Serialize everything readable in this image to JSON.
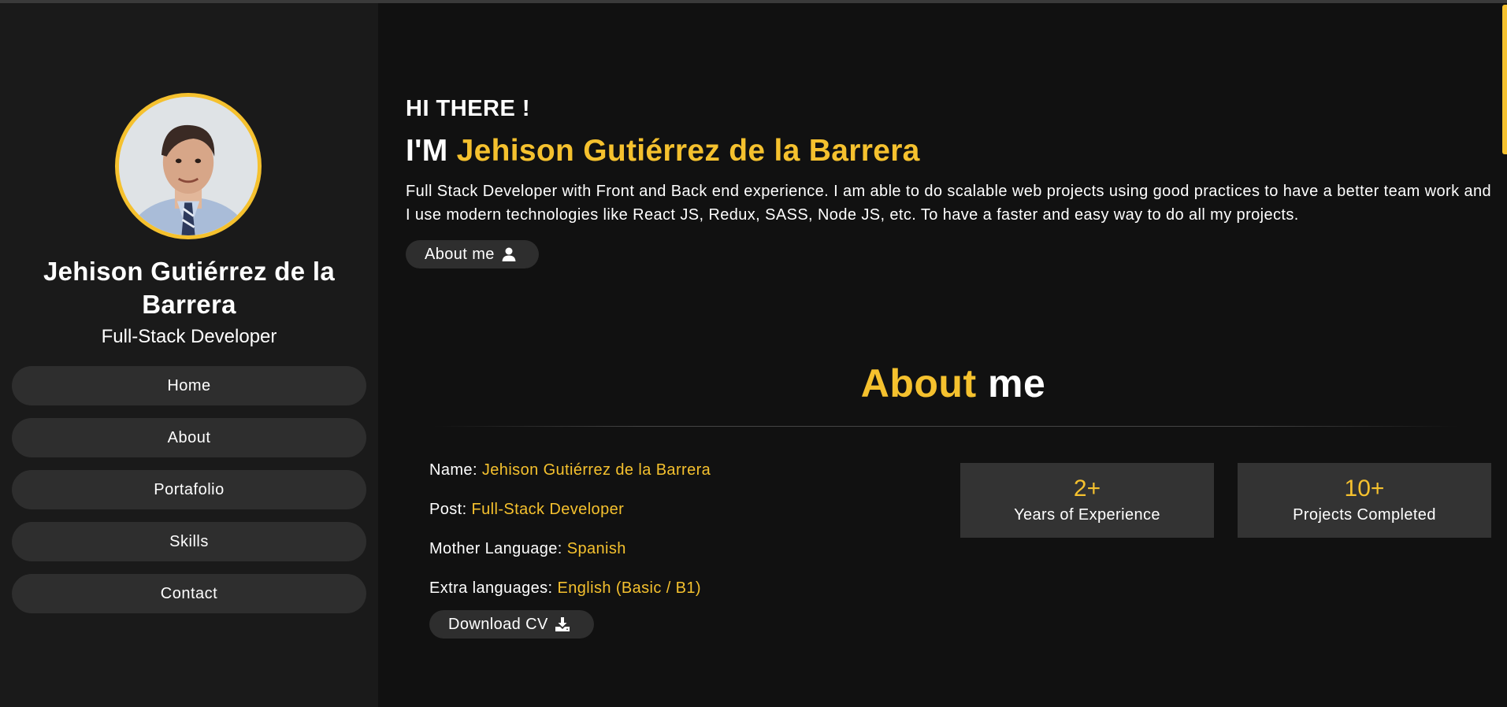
{
  "sidebar": {
    "profile_name": "Jehison Gutiérrez de la Barrera",
    "profile_role": "Full-Stack Developer",
    "nav_items": [
      {
        "label": "Home"
      },
      {
        "label": "About"
      },
      {
        "label": "Portafolio"
      },
      {
        "label": "Skills"
      },
      {
        "label": "Contact"
      }
    ]
  },
  "hero": {
    "greeting": "HI THERE !",
    "headline_prefix": "I'M ",
    "headline_name": "Jehison Gutiérrez de la Barrera",
    "intro": "Full Stack Developer with Front and Back end experience. I am able to do scalable web projects using good practices to have a better team work and I use modern technologies like React JS, Redux, SASS, Node JS, etc. To have a faster and easy way to do all my projects.",
    "about_button_label": "About me",
    "about_button_icon": "user-icon"
  },
  "about": {
    "title_accent": "About",
    "title_rest": " me",
    "info": [
      {
        "label": "Name: ",
        "value": "Jehison Gutiérrez de la Barrera"
      },
      {
        "label": "Post: ",
        "value": "Full-Stack Developer"
      },
      {
        "label": "Mother Language: ",
        "value": "Spanish"
      },
      {
        "label": "Extra languages: ",
        "value": "English (Basic / B1)"
      }
    ],
    "download_button_label": "Download CV",
    "download_button_icon": "download-icon",
    "stats": [
      {
        "value": "2+",
        "label": "Years of Experience"
      },
      {
        "value": "10+",
        "label": "Projects Completed"
      }
    ]
  },
  "colors": {
    "accent": "#f5c12e",
    "background": "#111111",
    "sidebar": "#1a1a1a",
    "button": "#2e2e2e",
    "card": "#333333"
  }
}
